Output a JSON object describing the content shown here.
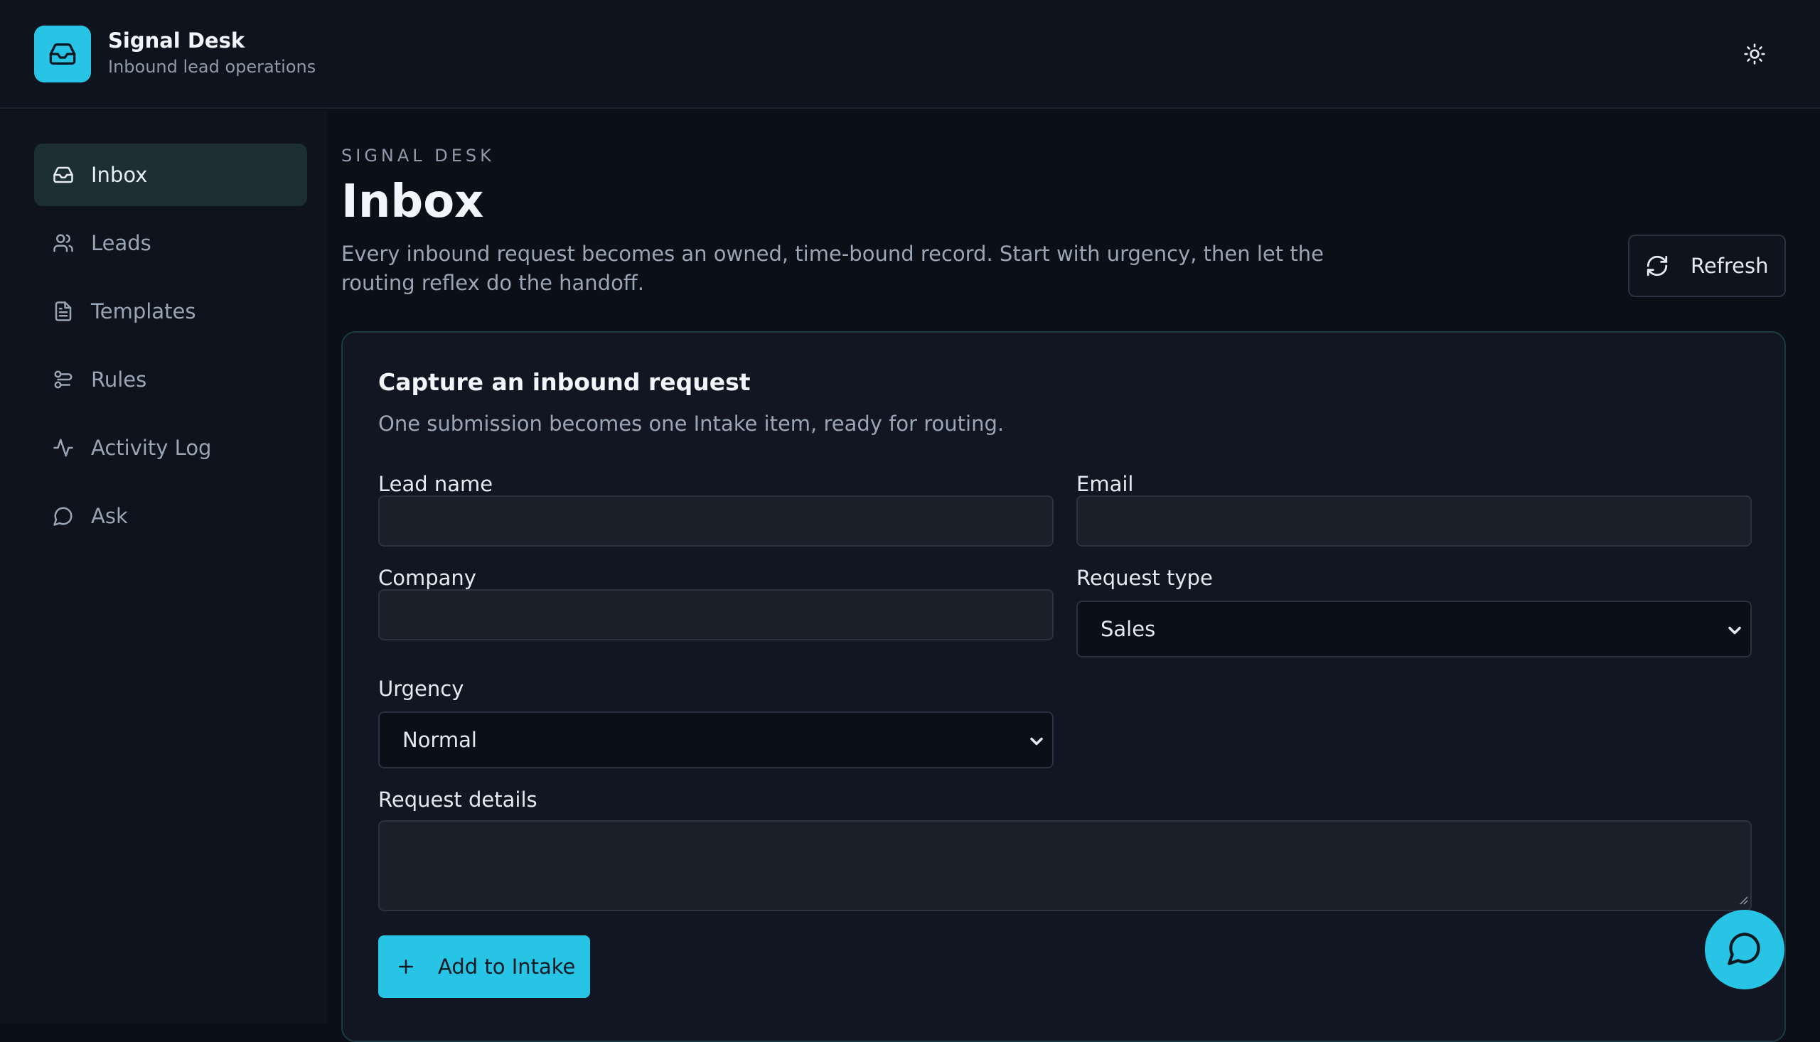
{
  "brand": {
    "title": "Signal Desk",
    "subtitle": "Inbound lead operations"
  },
  "sidebar": {
    "items": [
      {
        "label": "Inbox",
        "icon": "inbox-icon",
        "active": true
      },
      {
        "label": "Leads",
        "icon": "users-icon"
      },
      {
        "label": "Templates",
        "icon": "document-icon"
      },
      {
        "label": "Rules",
        "icon": "rules-icon"
      },
      {
        "label": "Activity Log",
        "icon": "activity-icon"
      },
      {
        "label": "Ask",
        "icon": "chat-icon"
      }
    ]
  },
  "header": {
    "eyebrow": "SIGNAL DESK",
    "title": "Inbox",
    "description": "Every inbound request becomes an owned, time-bound record. Start with urgency, then let the routing reflex do the handoff.",
    "refresh_label": "Refresh"
  },
  "form": {
    "title": "Capture an inbound request",
    "subtitle": "One submission becomes one Intake item, ready for routing.",
    "lead_name_label": "Lead name",
    "lead_name_value": "",
    "email_label": "Email",
    "email_value": "",
    "company_label": "Company",
    "company_value": "",
    "request_type_label": "Request type",
    "request_type_value": "Sales",
    "urgency_label": "Urgency",
    "urgency_value": "Normal",
    "details_label": "Request details",
    "submit_label": "Add to Intake"
  },
  "colors": {
    "accent": "#27c4e6",
    "background": "#0b0f17",
    "active_nav": "#1d2f33"
  }
}
